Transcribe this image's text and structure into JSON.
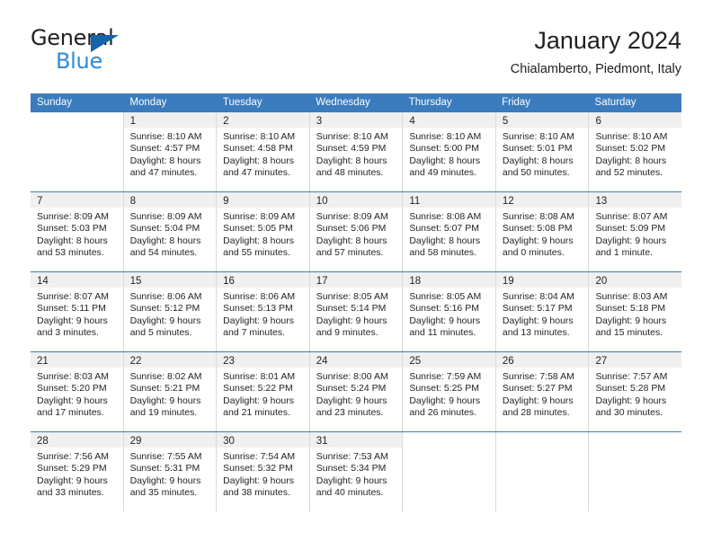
{
  "logo": {
    "word_dark": "General",
    "word_blue": "Blue",
    "triangle_color": "#1464aa",
    "blue_color": "#2e8bd6"
  },
  "header": {
    "title": "January 2024",
    "location": "Chialamberto, Piedmont, Italy"
  },
  "calendar": {
    "header_color": "#3a7cbe",
    "daynum_band_color": "#f0f0f0",
    "weekday_headers": [
      "Sunday",
      "Monday",
      "Tuesday",
      "Wednesday",
      "Thursday",
      "Friday",
      "Saturday"
    ],
    "weeks": [
      [
        {
          "day": "",
          "sunrise": "",
          "sunset": "",
          "daylight": ""
        },
        {
          "day": "1",
          "sunrise": "Sunrise: 8:10 AM",
          "sunset": "Sunset: 4:57 PM",
          "daylight": "Daylight: 8 hours and 47 minutes."
        },
        {
          "day": "2",
          "sunrise": "Sunrise: 8:10 AM",
          "sunset": "Sunset: 4:58 PM",
          "daylight": "Daylight: 8 hours and 47 minutes."
        },
        {
          "day": "3",
          "sunrise": "Sunrise: 8:10 AM",
          "sunset": "Sunset: 4:59 PM",
          "daylight": "Daylight: 8 hours and 48 minutes."
        },
        {
          "day": "4",
          "sunrise": "Sunrise: 8:10 AM",
          "sunset": "Sunset: 5:00 PM",
          "daylight": "Daylight: 8 hours and 49 minutes."
        },
        {
          "day": "5",
          "sunrise": "Sunrise: 8:10 AM",
          "sunset": "Sunset: 5:01 PM",
          "daylight": "Daylight: 8 hours and 50 minutes."
        },
        {
          "day": "6",
          "sunrise": "Sunrise: 8:10 AM",
          "sunset": "Sunset: 5:02 PM",
          "daylight": "Daylight: 8 hours and 52 minutes."
        }
      ],
      [
        {
          "day": "7",
          "sunrise": "Sunrise: 8:09 AM",
          "sunset": "Sunset: 5:03 PM",
          "daylight": "Daylight: 8 hours and 53 minutes."
        },
        {
          "day": "8",
          "sunrise": "Sunrise: 8:09 AM",
          "sunset": "Sunset: 5:04 PM",
          "daylight": "Daylight: 8 hours and 54 minutes."
        },
        {
          "day": "9",
          "sunrise": "Sunrise: 8:09 AM",
          "sunset": "Sunset: 5:05 PM",
          "daylight": "Daylight: 8 hours and 55 minutes."
        },
        {
          "day": "10",
          "sunrise": "Sunrise: 8:09 AM",
          "sunset": "Sunset: 5:06 PM",
          "daylight": "Daylight: 8 hours and 57 minutes."
        },
        {
          "day": "11",
          "sunrise": "Sunrise: 8:08 AM",
          "sunset": "Sunset: 5:07 PM",
          "daylight": "Daylight: 8 hours and 58 minutes."
        },
        {
          "day": "12",
          "sunrise": "Sunrise: 8:08 AM",
          "sunset": "Sunset: 5:08 PM",
          "daylight": "Daylight: 9 hours and 0 minutes."
        },
        {
          "day": "13",
          "sunrise": "Sunrise: 8:07 AM",
          "sunset": "Sunset: 5:09 PM",
          "daylight": "Daylight: 9 hours and 1 minute."
        }
      ],
      [
        {
          "day": "14",
          "sunrise": "Sunrise: 8:07 AM",
          "sunset": "Sunset: 5:11 PM",
          "daylight": "Daylight: 9 hours and 3 minutes."
        },
        {
          "day": "15",
          "sunrise": "Sunrise: 8:06 AM",
          "sunset": "Sunset: 5:12 PM",
          "daylight": "Daylight: 9 hours and 5 minutes."
        },
        {
          "day": "16",
          "sunrise": "Sunrise: 8:06 AM",
          "sunset": "Sunset: 5:13 PM",
          "daylight": "Daylight: 9 hours and 7 minutes."
        },
        {
          "day": "17",
          "sunrise": "Sunrise: 8:05 AM",
          "sunset": "Sunset: 5:14 PM",
          "daylight": "Daylight: 9 hours and 9 minutes."
        },
        {
          "day": "18",
          "sunrise": "Sunrise: 8:05 AM",
          "sunset": "Sunset: 5:16 PM",
          "daylight": "Daylight: 9 hours and 11 minutes."
        },
        {
          "day": "19",
          "sunrise": "Sunrise: 8:04 AM",
          "sunset": "Sunset: 5:17 PM",
          "daylight": "Daylight: 9 hours and 13 minutes."
        },
        {
          "day": "20",
          "sunrise": "Sunrise: 8:03 AM",
          "sunset": "Sunset: 5:18 PM",
          "daylight": "Daylight: 9 hours and 15 minutes."
        }
      ],
      [
        {
          "day": "21",
          "sunrise": "Sunrise: 8:03 AM",
          "sunset": "Sunset: 5:20 PM",
          "daylight": "Daylight: 9 hours and 17 minutes."
        },
        {
          "day": "22",
          "sunrise": "Sunrise: 8:02 AM",
          "sunset": "Sunset: 5:21 PM",
          "daylight": "Daylight: 9 hours and 19 minutes."
        },
        {
          "day": "23",
          "sunrise": "Sunrise: 8:01 AM",
          "sunset": "Sunset: 5:22 PM",
          "daylight": "Daylight: 9 hours and 21 minutes."
        },
        {
          "day": "24",
          "sunrise": "Sunrise: 8:00 AM",
          "sunset": "Sunset: 5:24 PM",
          "daylight": "Daylight: 9 hours and 23 minutes."
        },
        {
          "day": "25",
          "sunrise": "Sunrise: 7:59 AM",
          "sunset": "Sunset: 5:25 PM",
          "daylight": "Daylight: 9 hours and 26 minutes."
        },
        {
          "day": "26",
          "sunrise": "Sunrise: 7:58 AM",
          "sunset": "Sunset: 5:27 PM",
          "daylight": "Daylight: 9 hours and 28 minutes."
        },
        {
          "day": "27",
          "sunrise": "Sunrise: 7:57 AM",
          "sunset": "Sunset: 5:28 PM",
          "daylight": "Daylight: 9 hours and 30 minutes."
        }
      ],
      [
        {
          "day": "28",
          "sunrise": "Sunrise: 7:56 AM",
          "sunset": "Sunset: 5:29 PM",
          "daylight": "Daylight: 9 hours and 33 minutes."
        },
        {
          "day": "29",
          "sunrise": "Sunrise: 7:55 AM",
          "sunset": "Sunset: 5:31 PM",
          "daylight": "Daylight: 9 hours and 35 minutes."
        },
        {
          "day": "30",
          "sunrise": "Sunrise: 7:54 AM",
          "sunset": "Sunset: 5:32 PM",
          "daylight": "Daylight: 9 hours and 38 minutes."
        },
        {
          "day": "31",
          "sunrise": "Sunrise: 7:53 AM",
          "sunset": "Sunset: 5:34 PM",
          "daylight": "Daylight: 9 hours and 40 minutes."
        },
        {
          "day": "",
          "sunrise": "",
          "sunset": "",
          "daylight": ""
        },
        {
          "day": "",
          "sunrise": "",
          "sunset": "",
          "daylight": ""
        },
        {
          "day": "",
          "sunrise": "",
          "sunset": "",
          "daylight": ""
        }
      ]
    ]
  }
}
